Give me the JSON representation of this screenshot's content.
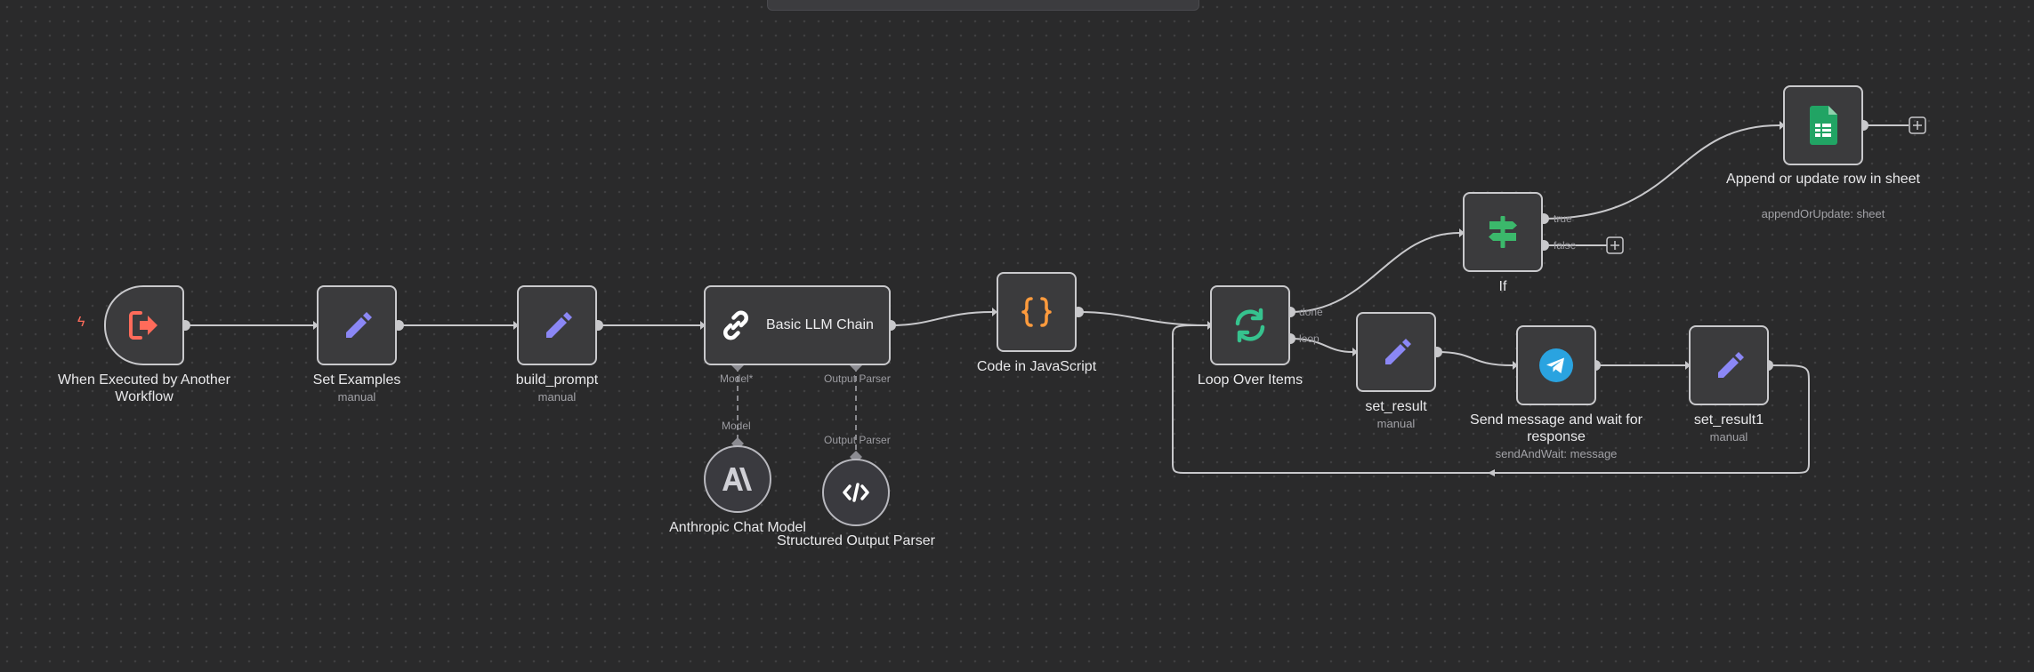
{
  "nodes": {
    "trigger": {
      "label": "When Executed by Another Workflow"
    },
    "set_examples": {
      "label": "Set Examples",
      "sub": "manual"
    },
    "build_prompt": {
      "label": "build_prompt",
      "sub": "manual"
    },
    "llm_chain": {
      "label": "Basic LLM Chain",
      "port_model": "Model*",
      "port_parser": "Output Parser"
    },
    "code": {
      "label": "Code in JavaScript"
    },
    "loop": {
      "label": "Loop Over Items",
      "port_done": "done",
      "port_loop": "loop"
    },
    "if": {
      "label": "If",
      "port_true": "true",
      "port_false": "false"
    },
    "sheet": {
      "label": "Append or update row in sheet",
      "sub": "appendOrUpdate: sheet"
    },
    "set_result": {
      "label": "set_result",
      "sub": "manual"
    },
    "telegram": {
      "label": "Send message and wait for response",
      "sub": "sendAndWait: message"
    },
    "set_result1": {
      "label": "set_result1",
      "sub": "manual"
    },
    "anthropic": {
      "label": "Anthropic Chat Model",
      "port": "Model"
    },
    "parser": {
      "label": "Structured Output Parser",
      "port": "Output Parser"
    }
  },
  "colors": {
    "accent_pencil": "#8b87f5",
    "trigger_red": "#ff6b5a",
    "code_orange": "#ff9b3d",
    "loop_green": "#36c28e",
    "if_green": "#3bb86b",
    "sheets_green": "#21a464",
    "telegram_blue": "#2aa3e0"
  },
  "icons": [
    "sign-out-icon",
    "pencil-icon",
    "link-icon",
    "braces-icon",
    "sync-icon",
    "signpost-icon",
    "google-sheets-icon",
    "telegram-icon",
    "anthropic-icon",
    "code-icon",
    "plus-icon",
    "lightning-icon"
  ]
}
